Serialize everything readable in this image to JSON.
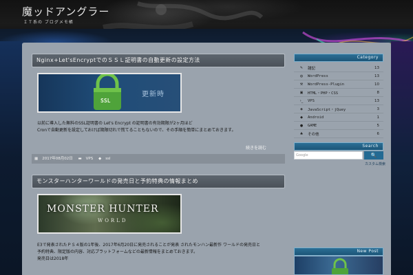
{
  "site": {
    "title": "魔ッドアングラー",
    "description": "ＩＴ系の ブログメモ帳"
  },
  "posts": [
    {
      "title": "Nginx+Let'sEncryptでのＳＳＬ証明書の自動更新の設定方法",
      "thumb_label_ssl": "SSL",
      "thumb_label_update": "更新時",
      "excerpt_lines": [
        "以前に導入した無料のSSL証明書の Let's Encrypt の証明書の有効期限が2ヶ月ほど",
        "Cronで自動更新を設定しておけば期限切れで慌てることもないので、その手順を簡単にまとめておきます。"
      ],
      "readmore": "続きを読む",
      "meta": {
        "date": "2017年08月02日",
        "category": "VPS",
        "tag": "ssl"
      }
    },
    {
      "title": "モンスターハンターワールドの発売日と予約特典の情報まとめ",
      "thumb_logo": "MONSTER HUNTER",
      "thumb_sub": "WORLD",
      "excerpt_lines": [
        "E3で発表されたＰＳ４版の1年後、2017年6月20日に発売されることが発表 されたモンハン最新作 ワールドの発売日と",
        "予約特典、限定版の内容、対応プラットフォームなどの最新情報をまとめておきます。",
        "発売日は2018年"
      ]
    }
  ],
  "sidebar": {
    "category_heading": "Category",
    "categories": [
      {
        "icon": "wrench-icon",
        "glyph": "✎",
        "name": "雑記",
        "count": "13"
      },
      {
        "icon": "wordpress-icon",
        "glyph": "◍",
        "name": "WordPress",
        "count": "13"
      },
      {
        "icon": "plugin-icon",
        "glyph": "⚒",
        "name": "WordPress-Plugin",
        "count": "10"
      },
      {
        "icon": "code-icon",
        "glyph": "▣",
        "name": "HTML・PHP・CSS",
        "count": "8"
      },
      {
        "icon": "terminal-icon",
        "glyph": "›_",
        "name": "VPS",
        "count": "13"
      },
      {
        "icon": "js-icon",
        "glyph": "◈",
        "name": "JavaScript・jQuey",
        "count": "3"
      },
      {
        "icon": "android-icon",
        "glyph": "◆",
        "name": "Android",
        "count": "1"
      },
      {
        "icon": "gamepad-icon",
        "glyph": "●",
        "name": "GAME",
        "count": "5"
      },
      {
        "icon": "sitemap-icon",
        "glyph": "♣",
        "name": "その他",
        "count": "6"
      }
    ],
    "search_heading": "Search",
    "search_placeholder": "Google",
    "search_button": "🔍",
    "search_footer": "カスタム検索",
    "new_post_heading": "New Post"
  },
  "colors": {
    "panel": "#9aa3ad",
    "title_bar": "#4f565e",
    "widget_head": "#236a93"
  }
}
